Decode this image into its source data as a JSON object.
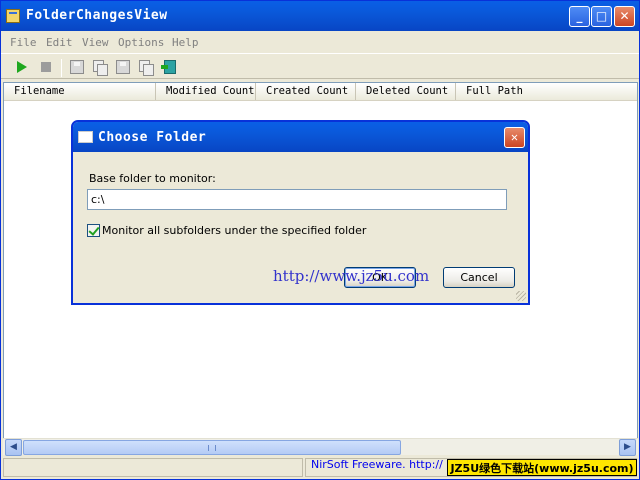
{
  "window": {
    "title": "FolderChangesView"
  },
  "menu": [
    "File",
    "Edit",
    "View",
    "Options",
    "Help"
  ],
  "toolbar": {
    "icons": [
      "start-icon",
      "stop-icon",
      "save-icon",
      "copy-icon",
      "properties-icon",
      "refresh-icon",
      "exit-icon"
    ]
  },
  "columns": [
    "Filename",
    "Modified Count",
    "Created Count",
    "Deleted Count",
    "Full Path"
  ],
  "dialog": {
    "title": "Choose Folder",
    "label": "Base folder to monitor:",
    "folder_value": "c:\\",
    "checkbox_label": "Monitor all subfolders under the specified folder",
    "checkbox_checked": true,
    "ok_label": "OK",
    "cancel_label": "Cancel"
  },
  "watermark": "http://www.jz5u.com",
  "status": {
    "link_text": "NirSoft Freeware.  http://",
    "badge": "JZ5U绿色下载站(www.jz5u.com)"
  },
  "colors": {
    "titlebar": "#0a58d9",
    "close": "#cc4422",
    "link": "#0000ee",
    "badge": "#ffe600"
  }
}
